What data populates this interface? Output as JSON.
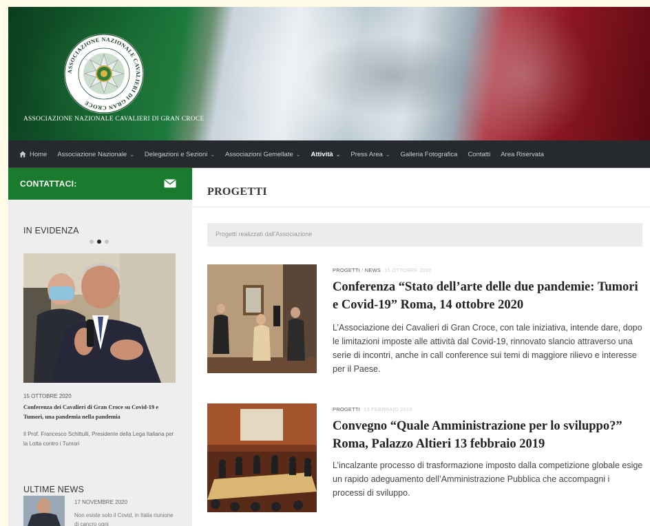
{
  "header": {
    "org_name": "Associazione Nazionale Cavalieri di Gran Croce",
    "seal_text": "ASSOCIAZIONE NAZIONALE CAVALIERI DI GRAN CROCE"
  },
  "nav": {
    "items": [
      {
        "label": "Home",
        "icon": "home-icon",
        "dropdown": false,
        "active": false
      },
      {
        "label": "Associazione Nazionale",
        "dropdown": true,
        "active": false
      },
      {
        "label": "Delegazioni e Sezioni",
        "dropdown": true,
        "active": false
      },
      {
        "label": "Associazioni Gemellate",
        "dropdown": true,
        "active": false
      },
      {
        "label": "Attività",
        "dropdown": true,
        "active": true
      },
      {
        "label": "Press Area",
        "dropdown": true,
        "active": false
      },
      {
        "label": "Galleria Fotografica",
        "dropdown": false,
        "active": false
      },
      {
        "label": "Contatti",
        "dropdown": false,
        "active": false
      },
      {
        "label": "Area Riservata",
        "dropdown": false,
        "active": false
      }
    ]
  },
  "sidebar": {
    "contact_label": "CONTATTACI:",
    "contact_icon": "mail-icon",
    "featured_title": "IN EVIDENZA",
    "featured": {
      "date": "15 OTTOBRE 2020",
      "title": "Conferenza dei Cavalieri di Gran Croce su Covid-19 e Tumori, una pandemia nella pandemia",
      "excerpt": "Il Prof. Francesco Schittulli, Presidente della Lega Italiana per la Lotta contro i Tumori"
    },
    "news_title": "ULTIME NEWS",
    "news": [
      {
        "date": "17 NOVEMBRE 2020",
        "text": "Non esiste solo il Covid, in Italia riunione di cancro ogni"
      }
    ]
  },
  "main": {
    "page_title": "PROGETTI",
    "description": "Progetti realizzati dall'Associazione",
    "articles": [
      {
        "category1": "PROGETTI",
        "category2": "NEWS",
        "date": "15 OTTOBRE 2020",
        "title": "Conferenza “Stato dell’arte delle due pandemie: Tumori e Covid-19” Roma, 14 ottobre 2020",
        "excerpt": "L’Associazione dei Cavalieri di Gran Croce, con tale iniziativa, intende dare, dopo le limitazioni imposte alle attività dal Covid-19, rinnovato slancio attraverso una serie di incontri, anche in call conference sui temi di maggiore rilievo e interesse per il Paese."
      },
      {
        "category1": "PROGETTI",
        "date": "13 FEBBRAIO 2019",
        "title": "Convegno “Quale Amministrazione per lo sviluppo?” Roma, Palazzo Altieri 13 febbraio 2019",
        "excerpt": "L’incalzante processo di trasformazione imposto dalla competizione globale esige un rapido adeguamento dell’Amministrazione Pubblica che accompagni i processi di sviluppo."
      }
    ]
  },
  "colors": {
    "nav_bg": "#262a2e",
    "contact_green": "#1a7a2e",
    "sidebar_bg": "#eeeeee"
  }
}
